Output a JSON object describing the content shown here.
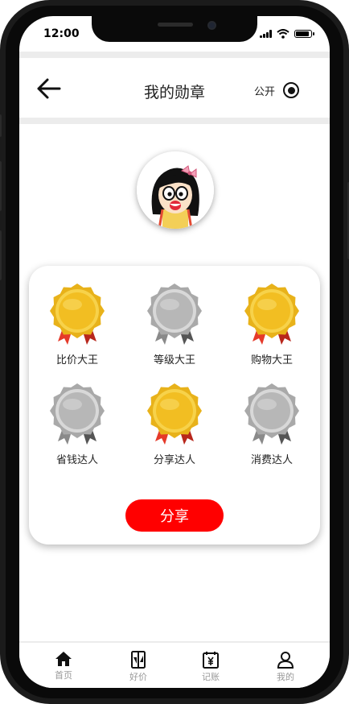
{
  "status_bar": {
    "time": "12:00"
  },
  "header": {
    "title": "我的勋章",
    "public_label": "公开"
  },
  "badges": [
    {
      "label": "比价大王",
      "type": "gold"
    },
    {
      "label": "等级大王",
      "type": "silver"
    },
    {
      "label": "购物大王",
      "type": "gold"
    },
    {
      "label": "省钱达人",
      "type": "silver"
    },
    {
      "label": "分享达人",
      "type": "gold"
    },
    {
      "label": "消费达人",
      "type": "silver"
    }
  ],
  "share_label": "分享",
  "tabbar": {
    "items": [
      {
        "label": "首页",
        "icon": "home-icon"
      },
      {
        "label": "好价",
        "icon": "price-tag-icon"
      },
      {
        "label": "记账",
        "icon": "calendar-yen-icon"
      },
      {
        "label": "我的",
        "icon": "user-icon"
      }
    ]
  },
  "colors": {
    "accent": "#ff0000",
    "gold": "#f2be22",
    "silver": "#b7b7b7",
    "ribbon": "#e53a2a"
  }
}
